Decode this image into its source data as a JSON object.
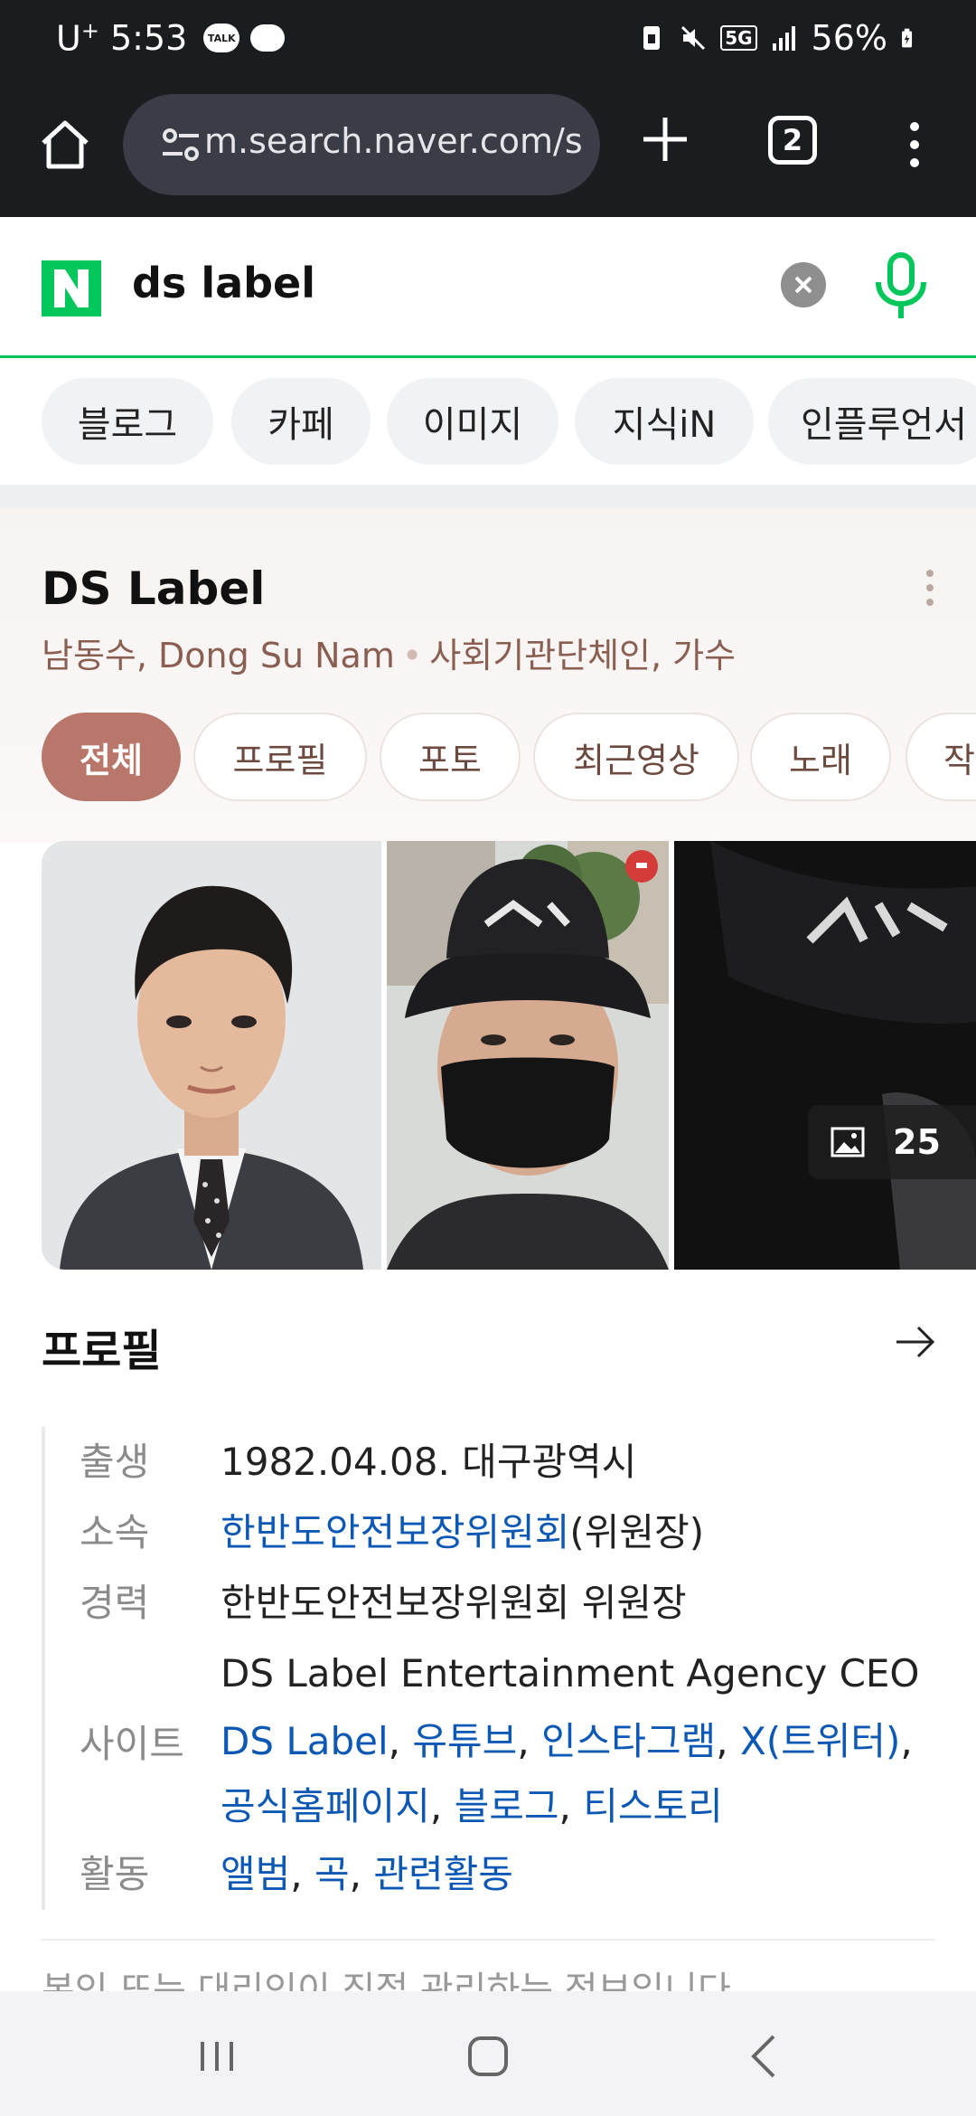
{
  "status_bar": {
    "carrier": "U",
    "carrier_sup": "+",
    "time": "5:53",
    "talk_badge": "TALK",
    "network": "5G",
    "battery": "56%"
  },
  "browser": {
    "url": "m.search.naver.com/se",
    "tab_count": "2"
  },
  "search": {
    "query": "ds label"
  },
  "verticals": [
    "블로그",
    "카페",
    "이미지",
    "지식iN",
    "인플루언서"
  ],
  "panel": {
    "title": "DS Label",
    "subtitle_name": "남동수, Dong Su Nam",
    "subtitle_sep": "•",
    "subtitle_role": "사회기관단체인, 가수",
    "tabs": [
      "전체",
      "프로필",
      "포토",
      "최근영상",
      "노래",
      "작"
    ],
    "active_tab": "전체",
    "photo_count": "25",
    "section_title": "프로필",
    "profile": {
      "birth_label": "출생",
      "birth_value": "1982.04.08. 대구광역시",
      "affil_label": "소속",
      "affil_link": "한반도안전보장위원회",
      "affil_suffix": "(위원장)",
      "career_label": "경력",
      "career_1": "한반도안전보장위원회 위원장",
      "career_2": "DS Label Entertainment Agency CEO",
      "site_label": "사이트",
      "sites_line1": [
        "DS Label",
        "유튜브",
        "인스타그램",
        "X(트위터)"
      ],
      "sites_line2": [
        "공식홈페이지",
        "블로그",
        "티스토리"
      ],
      "activity_label": "활동",
      "activities": [
        "앨범",
        "곡",
        "관련활동"
      ],
      "separator": ","
    },
    "clipped_text": "본인 또는 대리인이 직접 관리하는 정보입니다."
  },
  "colors": {
    "naver_green": "#03c75a",
    "link_blue": "#0d58b4",
    "accent_brown": "#b8776a"
  }
}
